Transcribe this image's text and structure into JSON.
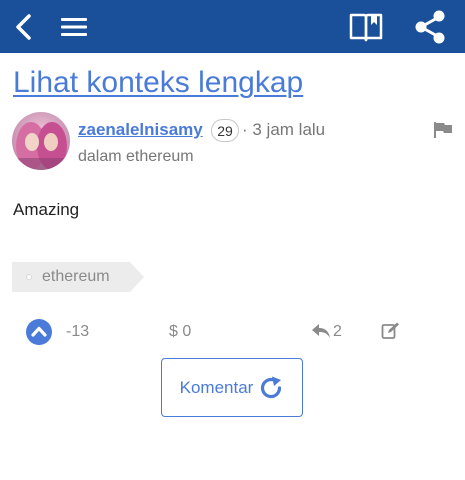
{
  "toolbar": {
    "back_icon": "chevron-left-icon",
    "menu_icon": "hamburger-menu-icon",
    "book_icon": "book-icon",
    "share_icon": "share-icon",
    "background": "#1a5099"
  },
  "post": {
    "context_link": "Lihat konteks lengkap",
    "author": "zaenalelnisamy",
    "reputation": "29",
    "time_ago": "· 3 jam lalu",
    "community": "dalam ethereum",
    "body": "Amazing",
    "tag": "ethereum"
  },
  "actions": {
    "vote_count": "-13",
    "payout": "$ 0",
    "reply_count": "2",
    "comment_label": "Komentar"
  },
  "colors": {
    "link": "#4a7bd8",
    "muted": "#8a8a8a"
  }
}
